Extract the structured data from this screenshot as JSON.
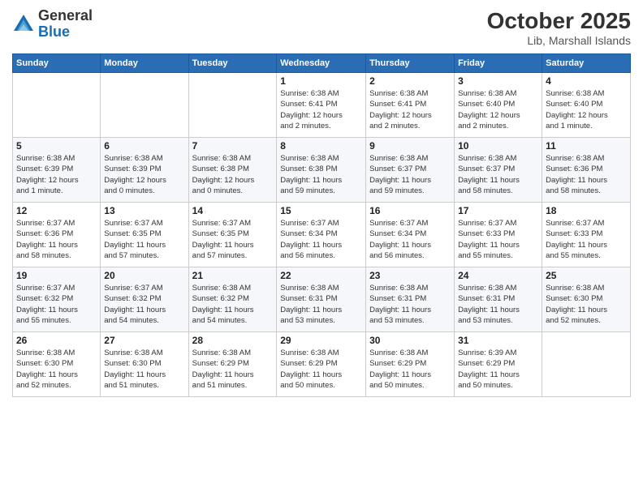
{
  "logo": {
    "general": "General",
    "blue": "Blue"
  },
  "header": {
    "month": "October 2025",
    "location": "Lib, Marshall Islands"
  },
  "weekdays": [
    "Sunday",
    "Monday",
    "Tuesday",
    "Wednesday",
    "Thursday",
    "Friday",
    "Saturday"
  ],
  "weeks": [
    [
      {
        "day": "",
        "info": ""
      },
      {
        "day": "",
        "info": ""
      },
      {
        "day": "",
        "info": ""
      },
      {
        "day": "1",
        "info": "Sunrise: 6:38 AM\nSunset: 6:41 PM\nDaylight: 12 hours\nand 2 minutes."
      },
      {
        "day": "2",
        "info": "Sunrise: 6:38 AM\nSunset: 6:41 PM\nDaylight: 12 hours\nand 2 minutes."
      },
      {
        "day": "3",
        "info": "Sunrise: 6:38 AM\nSunset: 6:40 PM\nDaylight: 12 hours\nand 2 minutes."
      },
      {
        "day": "4",
        "info": "Sunrise: 6:38 AM\nSunset: 6:40 PM\nDaylight: 12 hours\nand 1 minute."
      }
    ],
    [
      {
        "day": "5",
        "info": "Sunrise: 6:38 AM\nSunset: 6:39 PM\nDaylight: 12 hours\nand 1 minute."
      },
      {
        "day": "6",
        "info": "Sunrise: 6:38 AM\nSunset: 6:39 PM\nDaylight: 12 hours\nand 0 minutes."
      },
      {
        "day": "7",
        "info": "Sunrise: 6:38 AM\nSunset: 6:38 PM\nDaylight: 12 hours\nand 0 minutes."
      },
      {
        "day": "8",
        "info": "Sunrise: 6:38 AM\nSunset: 6:38 PM\nDaylight: 11 hours\nand 59 minutes."
      },
      {
        "day": "9",
        "info": "Sunrise: 6:38 AM\nSunset: 6:37 PM\nDaylight: 11 hours\nand 59 minutes."
      },
      {
        "day": "10",
        "info": "Sunrise: 6:38 AM\nSunset: 6:37 PM\nDaylight: 11 hours\nand 58 minutes."
      },
      {
        "day": "11",
        "info": "Sunrise: 6:38 AM\nSunset: 6:36 PM\nDaylight: 11 hours\nand 58 minutes."
      }
    ],
    [
      {
        "day": "12",
        "info": "Sunrise: 6:37 AM\nSunset: 6:36 PM\nDaylight: 11 hours\nand 58 minutes."
      },
      {
        "day": "13",
        "info": "Sunrise: 6:37 AM\nSunset: 6:35 PM\nDaylight: 11 hours\nand 57 minutes."
      },
      {
        "day": "14",
        "info": "Sunrise: 6:37 AM\nSunset: 6:35 PM\nDaylight: 11 hours\nand 57 minutes."
      },
      {
        "day": "15",
        "info": "Sunrise: 6:37 AM\nSunset: 6:34 PM\nDaylight: 11 hours\nand 56 minutes."
      },
      {
        "day": "16",
        "info": "Sunrise: 6:37 AM\nSunset: 6:34 PM\nDaylight: 11 hours\nand 56 minutes."
      },
      {
        "day": "17",
        "info": "Sunrise: 6:37 AM\nSunset: 6:33 PM\nDaylight: 11 hours\nand 55 minutes."
      },
      {
        "day": "18",
        "info": "Sunrise: 6:37 AM\nSunset: 6:33 PM\nDaylight: 11 hours\nand 55 minutes."
      }
    ],
    [
      {
        "day": "19",
        "info": "Sunrise: 6:37 AM\nSunset: 6:32 PM\nDaylight: 11 hours\nand 55 minutes."
      },
      {
        "day": "20",
        "info": "Sunrise: 6:37 AM\nSunset: 6:32 PM\nDaylight: 11 hours\nand 54 minutes."
      },
      {
        "day": "21",
        "info": "Sunrise: 6:38 AM\nSunset: 6:32 PM\nDaylight: 11 hours\nand 54 minutes."
      },
      {
        "day": "22",
        "info": "Sunrise: 6:38 AM\nSunset: 6:31 PM\nDaylight: 11 hours\nand 53 minutes."
      },
      {
        "day": "23",
        "info": "Sunrise: 6:38 AM\nSunset: 6:31 PM\nDaylight: 11 hours\nand 53 minutes."
      },
      {
        "day": "24",
        "info": "Sunrise: 6:38 AM\nSunset: 6:31 PM\nDaylight: 11 hours\nand 53 minutes."
      },
      {
        "day": "25",
        "info": "Sunrise: 6:38 AM\nSunset: 6:30 PM\nDaylight: 11 hours\nand 52 minutes."
      }
    ],
    [
      {
        "day": "26",
        "info": "Sunrise: 6:38 AM\nSunset: 6:30 PM\nDaylight: 11 hours\nand 52 minutes."
      },
      {
        "day": "27",
        "info": "Sunrise: 6:38 AM\nSunset: 6:30 PM\nDaylight: 11 hours\nand 51 minutes."
      },
      {
        "day": "28",
        "info": "Sunrise: 6:38 AM\nSunset: 6:29 PM\nDaylight: 11 hours\nand 51 minutes."
      },
      {
        "day": "29",
        "info": "Sunrise: 6:38 AM\nSunset: 6:29 PM\nDaylight: 11 hours\nand 50 minutes."
      },
      {
        "day": "30",
        "info": "Sunrise: 6:38 AM\nSunset: 6:29 PM\nDaylight: 11 hours\nand 50 minutes."
      },
      {
        "day": "31",
        "info": "Sunrise: 6:39 AM\nSunset: 6:29 PM\nDaylight: 11 hours\nand 50 minutes."
      },
      {
        "day": "",
        "info": ""
      }
    ]
  ]
}
